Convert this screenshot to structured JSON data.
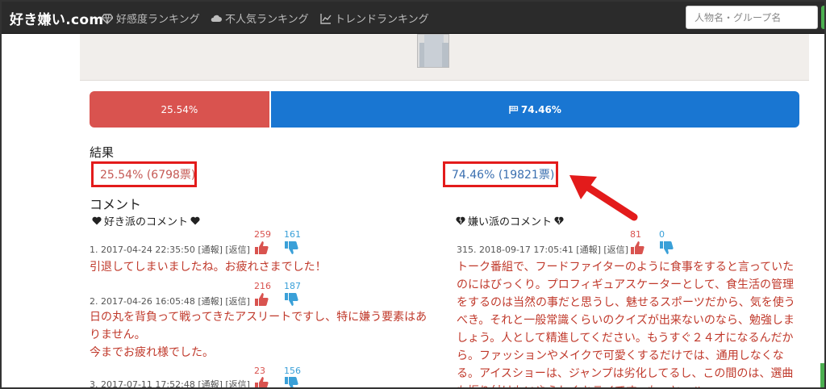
{
  "nav": {
    "brand": "好き嫌い.com",
    "items": [
      "好感度ランキング",
      "不人気ランキング",
      "トレンドランキング"
    ],
    "search_placeholder": "人物名・グループ名"
  },
  "vote_bar": {
    "like_percent": 25.54,
    "like_label": "25.54%",
    "dislike_label": "74.46%"
  },
  "result": {
    "heading": "結果",
    "like_result": "25.54% (6798票)",
    "dislike_result": "74.46% (19821票)"
  },
  "comments": {
    "heading": "コメント",
    "like_section": "好き派のコメント",
    "dislike_section": "嫌い派のコメント",
    "like_items": [
      {
        "meta": "1. 2017-04-24 22:35:50 [通報] [返信]",
        "up": "259",
        "down": "161",
        "text": "引退してしまいましたね。お疲れさまでした！"
      },
      {
        "meta": "2. 2017-04-26 16:05:48 [通報] [返信]",
        "up": "216",
        "down": "187",
        "text": "日の丸を背負って戦ってきたアスリートですし、特に嫌う要素はありません。\n今までお疲れ様でした。"
      },
      {
        "meta": "3. 2017-07-11 17:52:48 [通報] [返信]",
        "up": "23",
        "down": "156",
        "text": ""
      }
    ],
    "dislike_items": [
      {
        "meta": "315. 2018-09-17 17:05:41 [通報] [返信]",
        "up": "81",
        "down": "0",
        "text": "トーク番組で、フードファイターのように食事をすると言っていたのにはびっくり。プロフィギュアスケーターとして、食生活の管理をするのは当然の事だと思うし、魅せるスポーツだから、気を使うべき。それと一般常識くらいのクイズが出来ないのなら、勉強しましょう。人として精進してください。もうすぐ２４才になるんだから。ファッションやメイクで可愛くするだけでは、通用しなくなる。アイスショーは、ジャンプは劣化してるし、この間のは、選曲も振り付けもいやらしくキライです。もっと、ハッ"
      }
    ]
  },
  "colors": {
    "like": "#d9534f",
    "dislike": "#1976d2",
    "highlight": "#e31b1b"
  }
}
